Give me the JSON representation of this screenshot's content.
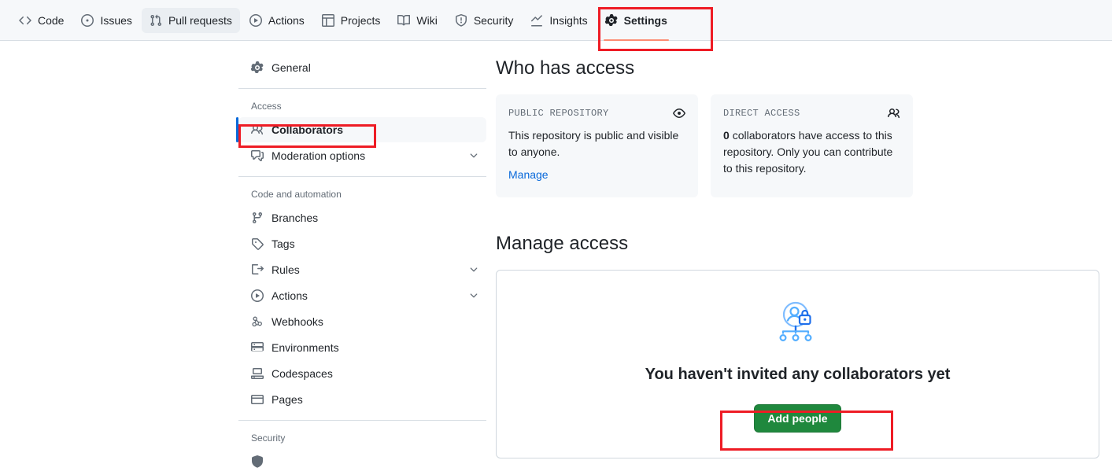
{
  "repo_nav": {
    "items": [
      {
        "label": "Code",
        "icon": "code-icon",
        "state": "default"
      },
      {
        "label": "Issues",
        "icon": "issue-opened-icon",
        "state": "default"
      },
      {
        "label": "Pull requests",
        "icon": "git-pull-request-icon",
        "state": "hovered"
      },
      {
        "label": "Actions",
        "icon": "play-icon",
        "state": "default"
      },
      {
        "label": "Projects",
        "icon": "table-icon",
        "state": "default"
      },
      {
        "label": "Wiki",
        "icon": "book-icon",
        "state": "default"
      },
      {
        "label": "Security",
        "icon": "shield-icon",
        "state": "default"
      },
      {
        "label": "Insights",
        "icon": "graph-icon",
        "state": "default"
      },
      {
        "label": "Settings",
        "icon": "gear-icon",
        "state": "active"
      }
    ]
  },
  "sidebar": {
    "top_items": [
      {
        "label": "General",
        "icon": "gear-icon",
        "chevron": false,
        "selected": false
      }
    ],
    "sections": [
      {
        "title": "Access",
        "items": [
          {
            "label": "Collaborators",
            "icon": "people-icon",
            "chevron": false,
            "selected": true
          },
          {
            "label": "Moderation options",
            "icon": "comment-discussion-icon",
            "chevron": true,
            "selected": false
          }
        ]
      },
      {
        "title": "Code and automation",
        "items": [
          {
            "label": "Branches",
            "icon": "git-branch-icon",
            "chevron": false,
            "selected": false
          },
          {
            "label": "Tags",
            "icon": "tag-icon",
            "chevron": false,
            "selected": false
          },
          {
            "label": "Rules",
            "icon": "rule-icon",
            "chevron": true,
            "selected": false
          },
          {
            "label": "Actions",
            "icon": "play-icon",
            "chevron": true,
            "selected": false
          },
          {
            "label": "Webhooks",
            "icon": "webhook-icon",
            "chevron": false,
            "selected": false
          },
          {
            "label": "Environments",
            "icon": "server-icon",
            "chevron": false,
            "selected": false
          },
          {
            "label": "Codespaces",
            "icon": "codespaces-icon",
            "chevron": false,
            "selected": false
          },
          {
            "label": "Pages",
            "icon": "browser-icon",
            "chevron": false,
            "selected": false
          }
        ]
      },
      {
        "title": "Security",
        "items": []
      }
    ]
  },
  "main": {
    "who_has_access": {
      "title": "Who has access",
      "cards": [
        {
          "label": "PUBLIC REPOSITORY",
          "icon": "eye-icon",
          "body": "This repository is public and visible to anyone.",
          "link": "Manage"
        },
        {
          "label": "DIRECT ACCESS",
          "icon": "people-icon",
          "body_bold": "0",
          "body": "collaborators have access to this repository. Only you can contribute to this repository."
        }
      ]
    },
    "manage_access": {
      "title": "Manage access",
      "empty_state": {
        "illustration": "person-lock-org-chart-illustration",
        "title": "You haven't invited any collaborators yet",
        "button": "Add people"
      }
    }
  },
  "annotations": {
    "color": "#ee1c25",
    "targets": [
      "Settings",
      "Collaborators",
      "Add people"
    ]
  },
  "colors": {
    "nav_bg": "#f6f8fa",
    "active_underline": "#fd8c73",
    "selected_bar": "#0969da",
    "link": "#0969da",
    "primary_button": "#1f883d",
    "annotation": "#ee1c25",
    "illustration": "#54aeff"
  }
}
